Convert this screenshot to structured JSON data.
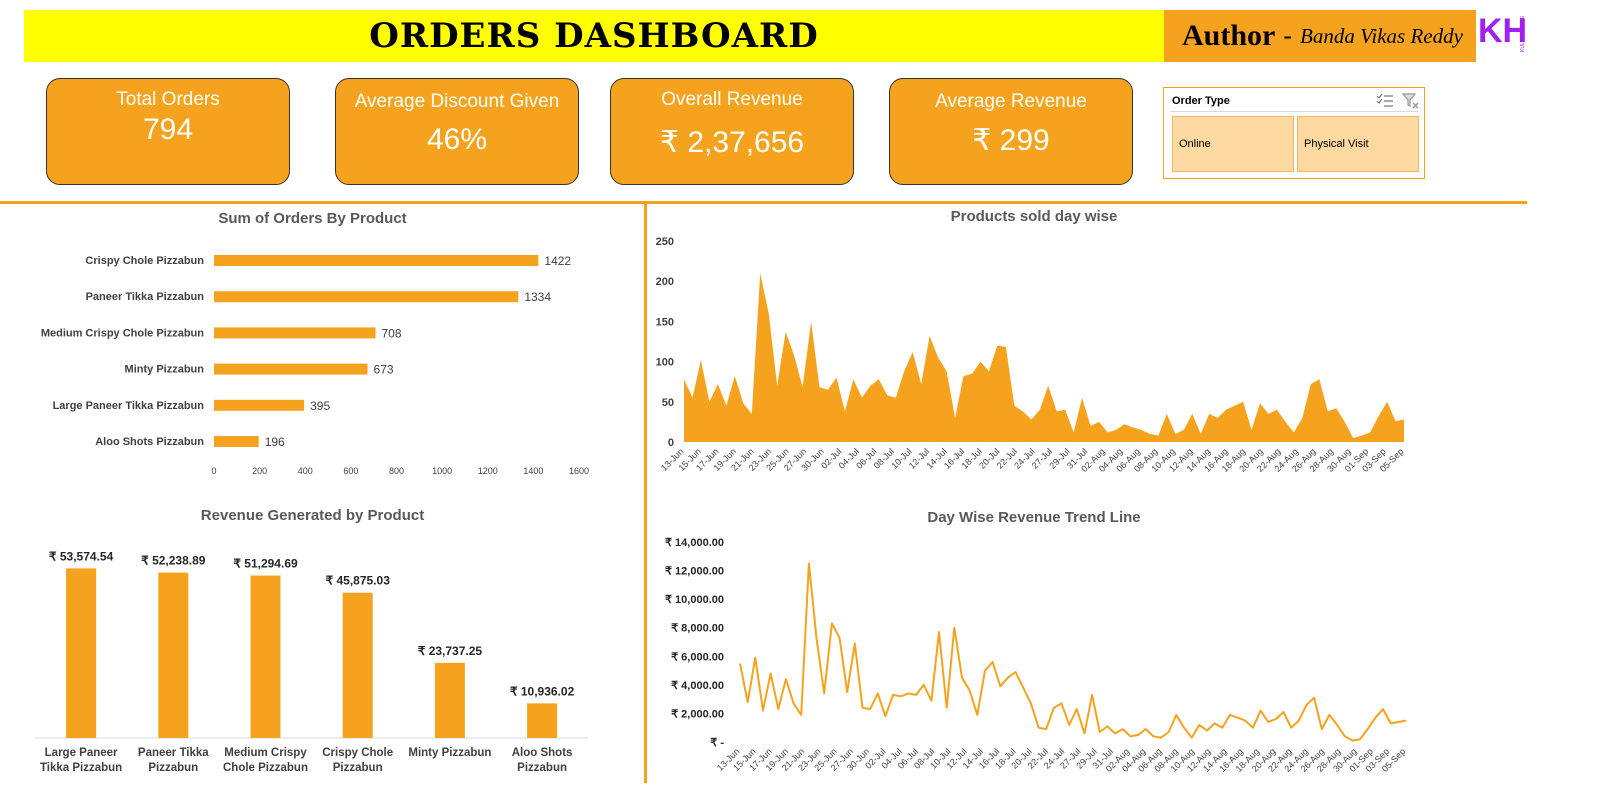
{
  "header": {
    "title": "ORDERS DASHBOARD",
    "author_label": "Author",
    "author_dash": "-",
    "author_name": "Banda Vikas Reddy",
    "logo_letters": "KH",
    "logo_caption": "KULTURE HIRE"
  },
  "colors": {
    "accent": "#f5a31e",
    "title_bg": "#ffff00",
    "slicer_fill": "#fcd9a0"
  },
  "kpis": [
    {
      "label": "Total Orders",
      "value": "794"
    },
    {
      "label": "Average Discount Given",
      "value": "46%"
    },
    {
      "label": "Overall Revenue",
      "value": "₹ 2,37,656"
    },
    {
      "label": "Average Revenue",
      "value": "₹ 299"
    }
  ],
  "slicer": {
    "title": "Order Type",
    "options": [
      "Online",
      "Physical Visit"
    ],
    "icons": [
      "multi-select-icon",
      "clear-filter-icon"
    ]
  },
  "chart_data": [
    {
      "type": "bar",
      "orientation": "horizontal",
      "title": "Sum of Orders By Product",
      "categories": [
        "Crispy Chole Pizzabun",
        "Paneer Tikka Pizzabun",
        "Medium Crispy Chole Pizzabun",
        "Minty Pizzabun",
        "Large Paneer Tikka Pizzabun",
        "Aloo Shots Pizzabun"
      ],
      "values": [
        1422,
        1334,
        708,
        673,
        395,
        196
      ],
      "xlim": [
        0,
        1600
      ],
      "xticks": [
        "0",
        "200",
        "400",
        "600",
        "800",
        "1000",
        "1200",
        "1400",
        "1600"
      ],
      "color": "#f5a31e"
    },
    {
      "type": "bar",
      "title": "Revenue Generated by Product",
      "categories": [
        "Large Paneer Tikka Pizzabun",
        "Paneer Tikka Pizzabun",
        "Medium Crispy Chole Pizzabun",
        "Crispy Chole Pizzabun",
        "Minty Pizzabun",
        "Aloo Shots Pizzabun"
      ],
      "category_lines": [
        [
          "Large Paneer",
          "Tikka Pizzabun"
        ],
        [
          "Paneer Tikka",
          "Pizzabun"
        ],
        [
          "Medium Crispy",
          "Chole Pizzabun"
        ],
        [
          "Crispy Chole",
          "Pizzabun"
        ],
        [
          "Minty Pizzabun"
        ],
        [
          "Aloo Shots",
          "Pizzabun"
        ]
      ],
      "values": [
        53574.54,
        52238.89,
        51294.69,
        45875.03,
        23737.25,
        10936.02
      ],
      "labels": [
        "₹ 53,574.54",
        "₹ 52,238.89",
        "₹ 51,294.69",
        "₹ 45,875.03",
        "₹ 23,737.25",
        "₹ 10,936.02"
      ],
      "ylim": [
        0,
        60000
      ],
      "color": "#f5a31e"
    },
    {
      "type": "area",
      "title": "Products sold day wise",
      "x_labels": [
        "13-Jun",
        "15-Jun",
        "17-Jun",
        "19-Jun",
        "21-Jun",
        "23-Jun",
        "25-Jun",
        "27-Jun",
        "30-Jun",
        "02-Jul",
        "04-Jul",
        "06-Jul",
        "08-Jul",
        "10-Jul",
        "12-Jul",
        "14-Jul",
        "16-Jul",
        "18-Jul",
        "20-Jul",
        "22-Jul",
        "24-Jul",
        "27-Jul",
        "29-Jul",
        "31-Jul",
        "02-Aug",
        "04-Aug",
        "06-Aug",
        "08-Aug",
        "10-Aug",
        "12-Aug",
        "14-Aug",
        "16-Aug",
        "18-Aug",
        "20-Aug",
        "22-Aug",
        "24-Aug",
        "26-Aug",
        "28-Aug",
        "30-Aug",
        "01-Sep",
        "03-Sep",
        "05-Sep"
      ],
      "values": [
        78,
        55,
        102,
        50,
        72,
        45,
        82,
        48,
        35,
        210,
        160,
        70,
        137,
        108,
        68,
        150,
        68,
        65,
        80,
        38,
        78,
        55,
        70,
        78,
        58,
        55,
        88,
        112,
        72,
        132,
        105,
        88,
        30,
        82,
        85,
        100,
        88,
        120,
        118,
        45,
        38,
        28,
        40,
        70,
        38,
        40,
        12,
        55,
        20,
        25,
        12,
        15,
        22,
        18,
        15,
        10,
        8,
        35,
        10,
        15,
        35,
        10,
        35,
        30,
        40,
        45,
        50,
        15,
        48,
        35,
        40,
        25,
        12,
        30,
        72,
        78,
        38,
        42,
        25,
        5,
        8,
        12,
        32,
        50,
        26,
        28
      ],
      "ylim": [
        0,
        250
      ],
      "yticks": [
        "0",
        "50",
        "100",
        "150",
        "200",
        "250"
      ],
      "color": "#f5a31e"
    },
    {
      "type": "line",
      "title": "Day Wise Revenue Trend Line",
      "x_labels": [
        "13-Jun",
        "15-Jun",
        "17-Jun",
        "19-Jun",
        "21-Jun",
        "23-Jun",
        "25-Jun",
        "27-Jun",
        "30-Jun",
        "02-Jul",
        "04-Jul",
        "06-Jul",
        "08-Jul",
        "10-Jul",
        "12-Jul",
        "14-Jul",
        "16-Jul",
        "18-Jul",
        "20-Jul",
        "22-Jul",
        "24-Jul",
        "27-Jul",
        "29-Jul",
        "31-Jul",
        "02-Aug",
        "04-Aug",
        "06-Aug",
        "08-Aug",
        "10-Aug",
        "12-Aug",
        "14-Aug",
        "16-Aug",
        "18-Aug",
        "20-Aug",
        "22-Aug",
        "24-Aug",
        "26-Aug",
        "28-Aug",
        "30-Aug",
        "01-Sep",
        "03-Sep",
        "05-Sep"
      ],
      "values": [
        5500,
        2800,
        5900,
        2200,
        4800,
        2300,
        4400,
        2700,
        1900,
        12500,
        7200,
        3400,
        8300,
        7300,
        3500,
        6900,
        2400,
        2300,
        3400,
        1800,
        3300,
        3200,
        3400,
        3300,
        4000,
        2900,
        7700,
        2400,
        8000,
        4500,
        3600,
        1900,
        5000,
        5600,
        3900,
        4500,
        4900,
        3800,
        2700,
        1000,
        900,
        2400,
        2700,
        1200,
        2300,
        600,
        3300,
        700,
        1100,
        600,
        900,
        400,
        500,
        900,
        400,
        300,
        700,
        1900,
        1000,
        300,
        1200,
        800,
        1300,
        1000,
        1900,
        1700,
        1500,
        1000,
        2200,
        1400,
        1600,
        2100,
        1000,
        1500,
        2600,
        3100,
        900,
        1900,
        1200,
        400,
        100,
        200,
        900,
        1700,
        2300,
        1300,
        1400,
        1500
      ],
      "ylim": [
        0,
        14000
      ],
      "yticks": [
        "₹ -",
        "₹ 2,000.00",
        "₹ 4,000.00",
        "₹ 6,000.00",
        "₹ 8,000.00",
        "₹ 10,000.00",
        "₹ 12,000.00",
        "₹ 14,000.00"
      ],
      "color": "#f5a31e"
    }
  ]
}
